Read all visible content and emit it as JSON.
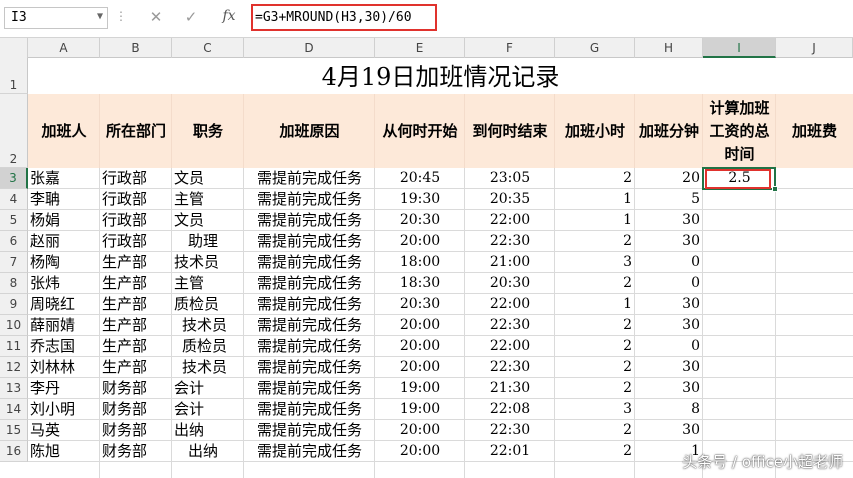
{
  "formula_bar": {
    "name_box": "I3",
    "cancel_glyph": "✕",
    "enter_glyph": "✓",
    "fx_label": "fx",
    "formula": "=G3+MROUND(H3,30)/60"
  },
  "columns": [
    "A",
    "B",
    "C",
    "D",
    "E",
    "F",
    "G",
    "H",
    "I",
    "J"
  ],
  "selected_column": "I",
  "rows": [
    "1",
    "2",
    "3",
    "4",
    "5",
    "6",
    "7",
    "8",
    "9",
    "10",
    "11",
    "12",
    "13",
    "14",
    "15",
    "16"
  ],
  "selected_row": "3",
  "sheet": {
    "title": "4月19日加班情况记录",
    "headers": {
      "A": "加班人",
      "B": "所在部门",
      "C": "职务",
      "D": "加班原因",
      "E": "从何时开始",
      "F": "到何时结束",
      "G": "加班小时",
      "H": "加班分钟",
      "I": "计算加班工资的总时间",
      "J": "加班费"
    },
    "records": [
      {
        "name": "张嘉",
        "dept": "行政部",
        "title": "文员",
        "reason": "需提前完成任务",
        "start": "20:45",
        "end": "23:05",
        "hours": "2",
        "minutes": "20",
        "total": "2.5"
      },
      {
        "name": "李聃",
        "dept": "行政部",
        "title": "主管",
        "reason": "需提前完成任务",
        "start": "19:30",
        "end": "20:35",
        "hours": "1",
        "minutes": "5",
        "total": ""
      },
      {
        "name": "杨娟",
        "dept": "行政部",
        "title": "文员",
        "reason": "需提前完成任务",
        "start": "20:30",
        "end": "22:00",
        "hours": "1",
        "minutes": "30",
        "total": ""
      },
      {
        "name": "赵丽",
        "dept": "行政部",
        "title": "助理",
        "reason": "需提前完成任务",
        "start": "20:00",
        "end": "22:30",
        "hours": "2",
        "minutes": "30",
        "total": ""
      },
      {
        "name": "杨陶",
        "dept": "生产部",
        "title": "技术员",
        "reason": "需提前完成任务",
        "start": "18:00",
        "end": "21:00",
        "hours": "3",
        "minutes": "0",
        "total": ""
      },
      {
        "name": "张炜",
        "dept": "生产部",
        "title": "主管",
        "reason": "需提前完成任务",
        "start": "18:30",
        "end": "20:30",
        "hours": "2",
        "minutes": "0",
        "total": ""
      },
      {
        "name": "周晓红",
        "dept": "生产部",
        "title": "质检员",
        "reason": "需提前完成任务",
        "start": "20:30",
        "end": "22:00",
        "hours": "1",
        "minutes": "30",
        "total": ""
      },
      {
        "name": "薛丽婧",
        "dept": "生产部",
        "title": "技术员",
        "reason": "需提前完成任务",
        "start": "20:00",
        "end": "22:30",
        "hours": "2",
        "minutes": "30",
        "total": ""
      },
      {
        "name": "乔志国",
        "dept": "生产部",
        "title": "质检员",
        "reason": "需提前完成任务",
        "start": "20:00",
        "end": "22:00",
        "hours": "2",
        "minutes": "0",
        "total": ""
      },
      {
        "name": "刘林林",
        "dept": "生产部",
        "title": "技术员",
        "reason": "需提前完成任务",
        "start": "20:00",
        "end": "22:30",
        "hours": "2",
        "minutes": "30",
        "total": ""
      },
      {
        "name": "李丹",
        "dept": "财务部",
        "title": "会计",
        "reason": "需提前完成任务",
        "start": "19:00",
        "end": "21:30",
        "hours": "2",
        "minutes": "30",
        "total": ""
      },
      {
        "name": "刘小明",
        "dept": "财务部",
        "title": "会计",
        "reason": "需提前完成任务",
        "start": "19:00",
        "end": "22:08",
        "hours": "3",
        "minutes": "8",
        "total": ""
      },
      {
        "name": "马英",
        "dept": "财务部",
        "title": "出纳",
        "reason": "需提前完成任务",
        "start": "20:00",
        "end": "22:30",
        "hours": "2",
        "minutes": "30",
        "total": ""
      },
      {
        "name": "陈旭",
        "dept": "财务部",
        "title": "出纳",
        "reason": "需提前完成任务",
        "start": "20:00",
        "end": "22:01",
        "hours": "2",
        "minutes": "1",
        "total": ""
      }
    ]
  },
  "watermark": "头条号 / office小超老师",
  "colors": {
    "header_fill": "#fde9d9",
    "selection_green": "#217346",
    "highlight_red": "#e0322d"
  }
}
